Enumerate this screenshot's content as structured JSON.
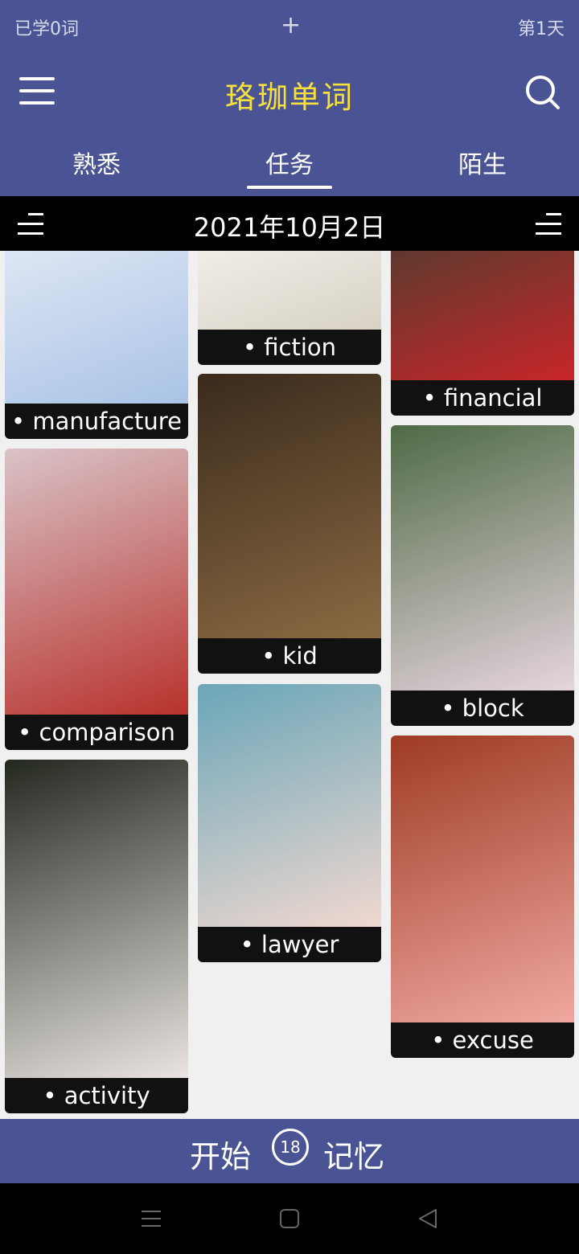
{
  "status": {
    "learned": "已学0词",
    "plus": "+",
    "day": "第1天"
  },
  "header": {
    "title": "珞珈单词"
  },
  "tabs": [
    {
      "label": "熟悉"
    },
    {
      "label": "任务"
    },
    {
      "label": "陌生"
    }
  ],
  "datebar": {
    "date": "2021年10月2日"
  },
  "cards": [
    {
      "word": "• manufacture",
      "colors": [
        "#dfe7f4",
        "#a9c3e6"
      ]
    },
    {
      "word": "• fiction",
      "colors": [
        "#f1efe9",
        "#d8d2c6"
      ]
    },
    {
      "word": "• financial",
      "colors": [
        "#5a3a2e",
        "#c8262a"
      ]
    },
    {
      "word": "• comparison",
      "colors": [
        "#d9c3c8",
        "#b8322c"
      ]
    },
    {
      "word": "• kid",
      "colors": [
        "#3a2a1c",
        "#8a6a42"
      ]
    },
    {
      "word": "• block",
      "colors": [
        "#4f6a45",
        "#e6d5de"
      ]
    },
    {
      "word": "• activity",
      "colors": [
        "#23281f",
        "#e9e4e2"
      ]
    },
    {
      "word": "• lawyer",
      "colors": [
        "#6aa6b8",
        "#f0d8d0"
      ]
    },
    {
      "word": "• excuse",
      "colors": [
        "#9e3b24",
        "#f0a8a0"
      ]
    }
  ],
  "bottom": {
    "start": "开始",
    "count": "18",
    "memory": "记忆"
  },
  "theme": {
    "primary": "#4a5494",
    "title_yellow": "#f7e03c"
  }
}
